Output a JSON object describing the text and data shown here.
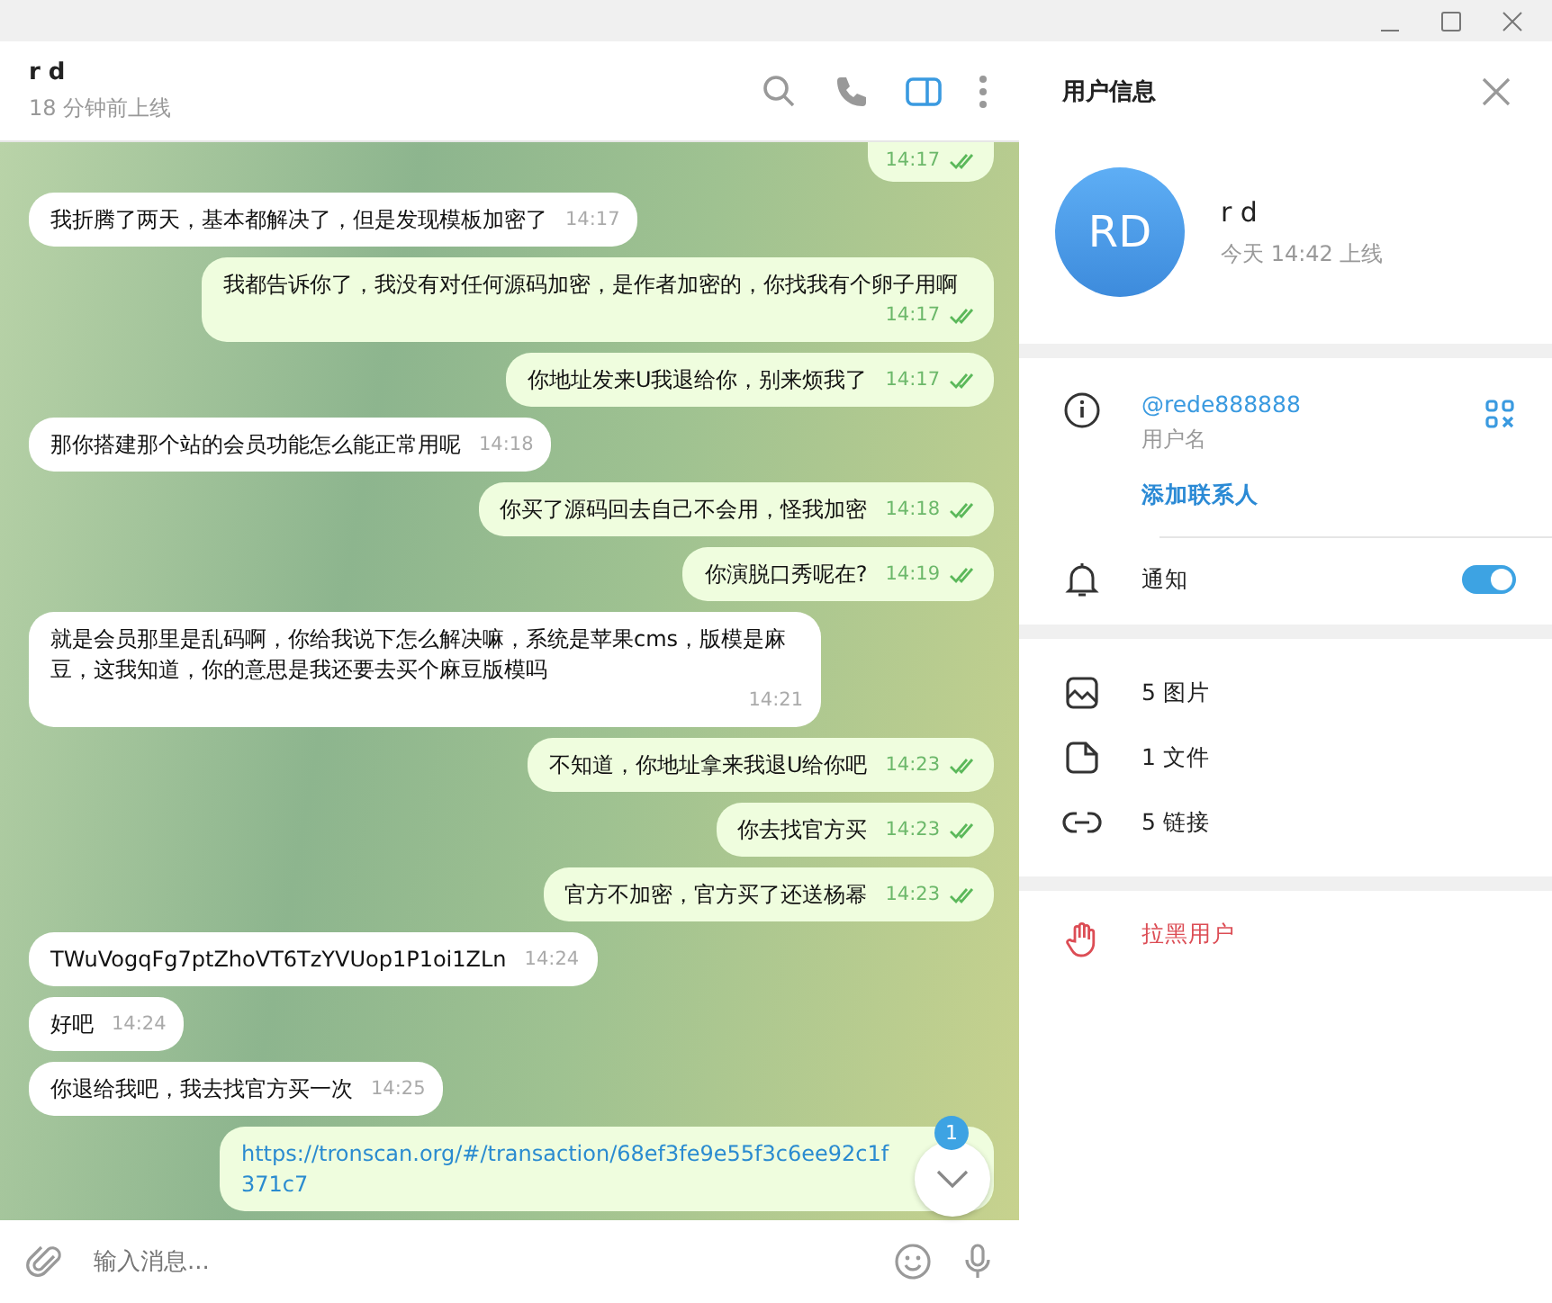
{
  "chat_header": {
    "name": "r d",
    "status": "18 分钟前上线"
  },
  "messages": [
    {
      "kind": "outgoing",
      "time": "14:17",
      "read": true
    },
    {
      "kind": "incoming",
      "text": "我折腾了两天，基本都解决了，但是发现模板加密了",
      "time": "14:17"
    },
    {
      "kind": "outgoing",
      "text": "我都告诉你了，我没有对任何源码加密，是作者加密的，你找我有个卵子用啊",
      "time": "14:17",
      "read": true
    },
    {
      "kind": "outgoing",
      "text": "你地址发来U我退给你，别来烦我了",
      "time": "14:17",
      "read": true
    },
    {
      "kind": "incoming",
      "text": "那你搭建那个站的会员功能怎么能正常用呢",
      "time": "14:18"
    },
    {
      "kind": "outgoing",
      "text": "你买了源码回去自己不会用，怪我加密",
      "time": "14:18",
      "read": true
    },
    {
      "kind": "outgoing",
      "text": "你演脱口秀呢在?",
      "time": "14:19",
      "read": true
    },
    {
      "kind": "incoming",
      "text": "就是会员那里是乱码啊，你给我说下怎么解决嘛，系统是苹果cms，版模是麻豆，这我知道，你的意思是我还要去买个麻豆版模吗",
      "time": "14:21"
    },
    {
      "kind": "outgoing",
      "text": "不知道，你地址拿来我退U给你吧",
      "time": "14:23",
      "read": true
    },
    {
      "kind": "outgoing",
      "text": "你去找官方买",
      "time": "14:23",
      "read": true
    },
    {
      "kind": "outgoing",
      "text": "官方不加密，官方买了还送杨幂",
      "time": "14:23",
      "read": true
    },
    {
      "kind": "incoming",
      "text": "TWuVogqFg7ptZhoVT6TzYVUop1P1oi1ZLn",
      "time": "14:24"
    },
    {
      "kind": "incoming",
      "text": "好吧",
      "time": "14:24"
    },
    {
      "kind": "incoming",
      "text": "你退给我吧，我去找官方买一次",
      "time": "14:25"
    },
    {
      "kind": "link",
      "text": "https://tronscan.org/#/transaction/68ef3fe9e55f3c6ee92c1f371c7"
    }
  ],
  "scroll_button": {
    "unread": "1"
  },
  "composer": {
    "placeholder": "输入消息..."
  },
  "user_info": {
    "title": "用户信息",
    "avatar_initials": "RD",
    "name": "r d",
    "status": "今天 14:42 上线",
    "username": "@rede888888",
    "username_label": "用户名",
    "add_contact": "添加联系人",
    "notifications": {
      "label": "通知",
      "on": true
    },
    "media": [
      {
        "kind": "photos",
        "label": "5 图片"
      },
      {
        "kind": "files",
        "label": "1 文件"
      },
      {
        "kind": "links",
        "label": "5 链接"
      }
    ],
    "block": "拉黑用户"
  }
}
